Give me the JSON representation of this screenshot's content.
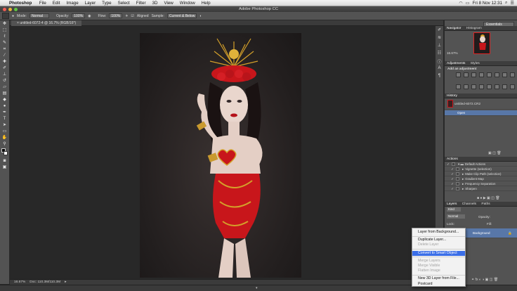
{
  "menubar": {
    "app_name": "Photoshop",
    "items": [
      "File",
      "Edit",
      "Image",
      "Layer",
      "Type",
      "Select",
      "Filter",
      "3D",
      "View",
      "Window",
      "Help"
    ],
    "clock": "Fri 8 Nov  12:31"
  },
  "window": {
    "title": "Adobe Photoshop CC"
  },
  "options_bar": {
    "mode_label": "Mode:",
    "mode_value": "Normal",
    "opacity_label": "Opacity:",
    "opacity_value": "100%",
    "flow_label": "Flow:",
    "flow_value": "100%",
    "aligned_label": "Aligned",
    "sample_label": "Sample:",
    "sample_value": "Current & Below",
    "workspace": "Essentials"
  },
  "document": {
    "tab": "untitled-6072-4 @ 16.7% (RGB/16*)",
    "zoom": "16.67%",
    "doc_info": "Doc: 110.3M/110.3M"
  },
  "panels": {
    "navigator_tabs": [
      "Navigator",
      "Histogram"
    ],
    "navigator_zoom": "16.67%",
    "adjustments_tabs": [
      "Adjustments",
      "Styles"
    ],
    "adjustments_hint": "Add an adjustment",
    "history_tab": "History",
    "history_snapshot": "untitled-6072.CR2",
    "history_items": [
      "Open"
    ],
    "actions_tab": "Actions",
    "actions": [
      {
        "label": "Default Actions",
        "folder": true
      },
      {
        "label": "Vignette (selection)",
        "folder": false
      },
      {
        "label": "Make Clip Path (selection)",
        "folder": false
      },
      {
        "label": "Gradient Map",
        "folder": false
      },
      {
        "label": "Frequency Separation",
        "folder": false
      },
      {
        "label": "Sharpen",
        "folder": false
      }
    ],
    "layers_tabs": [
      "Layers",
      "Channels",
      "Paths"
    ],
    "layers_kind": "Kind",
    "layers_mode": "Normal",
    "layers_opacity": "Opacity:",
    "layers_lock": "Lock:",
    "layers_fill": "Fill:",
    "layer_name": "Background"
  },
  "context_menu": {
    "groups": [
      [
        {
          "label": "Layer from Background...",
          "enabled": true
        }
      ],
      [
        {
          "label": "Duplicate Layer...",
          "enabled": true
        },
        {
          "label": "Delete Layer",
          "enabled": false
        }
      ],
      [
        {
          "label": "Convert to Smart Object",
          "enabled": true,
          "highlighted": true
        }
      ],
      [
        {
          "label": "Merge Layers",
          "enabled": false
        },
        {
          "label": "Merge Visible",
          "enabled": false
        },
        {
          "label": "Flatten Image",
          "enabled": false
        }
      ],
      [
        {
          "label": "New 3D Layer from File...",
          "enabled": true
        },
        {
          "label": "Postcard",
          "enabled": true
        }
      ]
    ]
  },
  "colors": {
    "panel_bg": "#535353",
    "canvas_bg": "#282828",
    "menu_highlight": "#3a6ee8",
    "selection_blue": "#5877a8",
    "costume_red": "#c8161b",
    "crown_gold": "#d4a02a"
  },
  "icons": {
    "tools": [
      "move-icon",
      "marquee-icon",
      "lasso-icon",
      "quick-select-icon",
      "crop-icon",
      "eyedropper-icon",
      "healing-icon",
      "brush-icon",
      "clone-stamp-icon",
      "history-brush-icon",
      "eraser-icon",
      "gradient-icon",
      "blur-icon",
      "dodge-icon",
      "pen-icon",
      "type-icon",
      "path-select-icon",
      "shape-icon",
      "hand-icon",
      "zoom-icon"
    ]
  }
}
